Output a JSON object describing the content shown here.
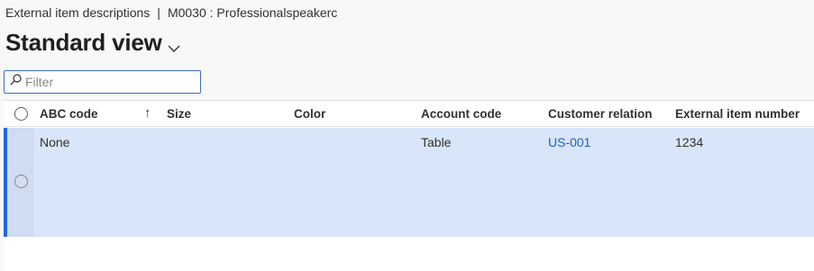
{
  "breadcrumb": {
    "page": "External item descriptions",
    "separator": "|",
    "record": "M0030 : Professionalspeakerc"
  },
  "view": {
    "title": "Standard view"
  },
  "filter": {
    "placeholder": "Filter",
    "value": ""
  },
  "grid": {
    "columns": [
      {
        "label": "ABC code"
      },
      {
        "label": "Size"
      },
      {
        "label": "Color"
      },
      {
        "label": "Account code"
      },
      {
        "label": "Customer relation"
      },
      {
        "label": "External item number"
      }
    ],
    "sort_indicator": "↑",
    "rows": [
      {
        "abc_code": "None",
        "size": "",
        "color": "",
        "account_code": "Table",
        "customer_relation": "US-001",
        "external_item_number": "1234"
      }
    ]
  },
  "colors": {
    "selected_row": "#d9e5f8",
    "accent": "#2266e3",
    "link": "#1f5fbf"
  }
}
